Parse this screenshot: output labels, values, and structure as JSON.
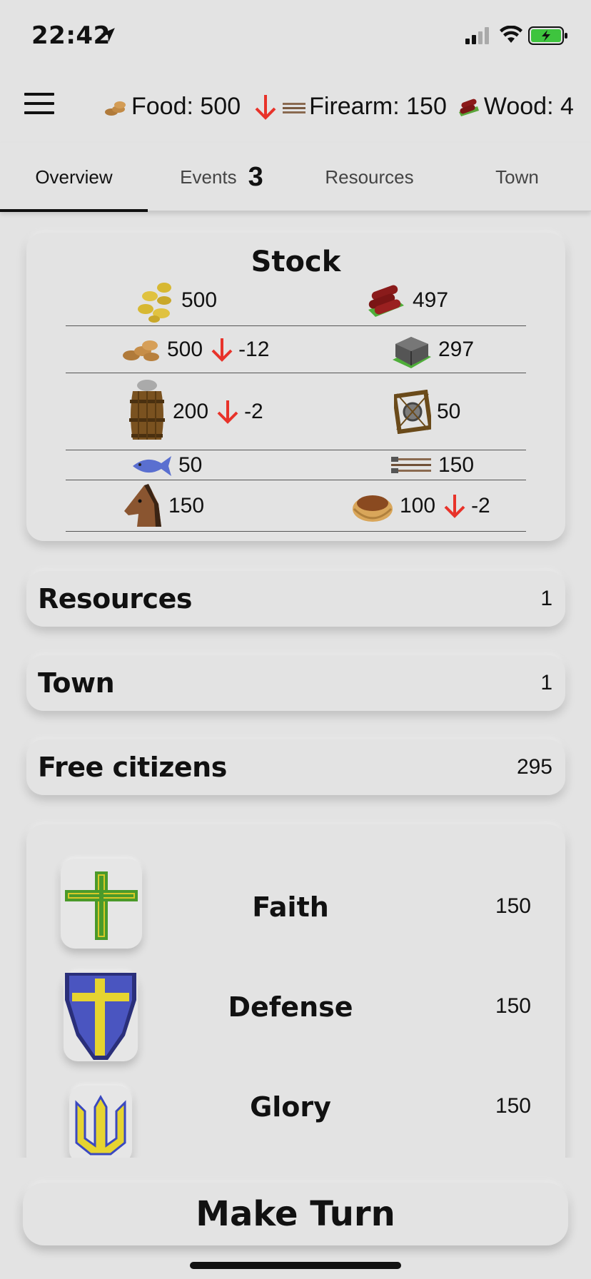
{
  "status_bar": {
    "time": "22:42"
  },
  "header": {
    "ticker": [
      {
        "icon": "coins-stack-icon",
        "label": "Food: 500",
        "trend": "down"
      },
      {
        "icon": "firearm-icon",
        "label": "Firearm: 150",
        "trend": "none"
      },
      {
        "icon": "wood-log-icon",
        "label": "Wood: 4",
        "trend": "none"
      }
    ]
  },
  "tabs": [
    {
      "label": "Overview",
      "active": true
    },
    {
      "label": "Events",
      "badge": "3"
    },
    {
      "label": "Resources"
    },
    {
      "label": "Town"
    }
  ],
  "stock": {
    "title": "Stock",
    "rows": [
      {
        "left": {
          "icon": "gold-coins-icon",
          "value": "500"
        },
        "right": {
          "icon": "wood-logs-icon",
          "value": "497"
        }
      },
      {
        "left": {
          "icon": "food-coins-icon",
          "value": "500",
          "delta": "-12"
        },
        "right": {
          "icon": "stone-block-icon",
          "value": "297"
        }
      },
      {
        "left": {
          "icon": "powder-barrel-icon",
          "value": "200",
          "delta": "-2"
        },
        "right": {
          "icon": "tool-frame-icon",
          "value": "50"
        }
      },
      {
        "left": {
          "icon": "fish-icon",
          "value": "50"
        },
        "right": {
          "icon": "firearms-icon",
          "value": "150"
        }
      },
      {
        "left": {
          "icon": "horse-icon",
          "value": "150"
        },
        "right": {
          "icon": "bread-basket-icon",
          "value": "100",
          "delta": "-2"
        }
      }
    ]
  },
  "sections": {
    "resources": {
      "label": "Resources",
      "value": "1"
    },
    "town": {
      "label": "Town",
      "value": "1"
    },
    "free_citizens": {
      "label": "Free citizens",
      "value": "295"
    }
  },
  "stats": [
    {
      "icon": "cross-icon",
      "label": "Faith",
      "value": "150"
    },
    {
      "icon": "shield-icon",
      "label": "Defense",
      "value": "150"
    },
    {
      "icon": "trident-icon",
      "label": "Glory",
      "value": "150"
    }
  ],
  "actions": {
    "make_turn": "Make Turn"
  },
  "colors": {
    "background": "#e3e3e3",
    "down_arrow": "#e8332a",
    "battery_green": "#3ec43e"
  }
}
